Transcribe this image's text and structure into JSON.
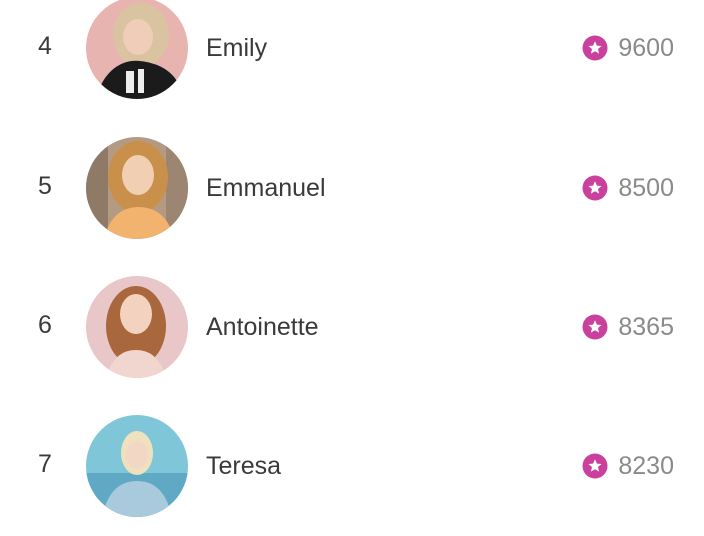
{
  "leaderboard": {
    "icon": "star-badge-icon",
    "accent_color": "#c9409d",
    "rows": [
      {
        "rank": "4",
        "name": "Emily",
        "score": "9600",
        "avatar": "avatar-photo"
      },
      {
        "rank": "5",
        "name": "Emmanuel",
        "score": "8500",
        "avatar": "avatar-photo"
      },
      {
        "rank": "6",
        "name": "Antoinette",
        "score": "8365",
        "avatar": "avatar-photo"
      },
      {
        "rank": "7",
        "name": "Teresa",
        "score": "8230",
        "avatar": "avatar-photo"
      }
    ]
  }
}
